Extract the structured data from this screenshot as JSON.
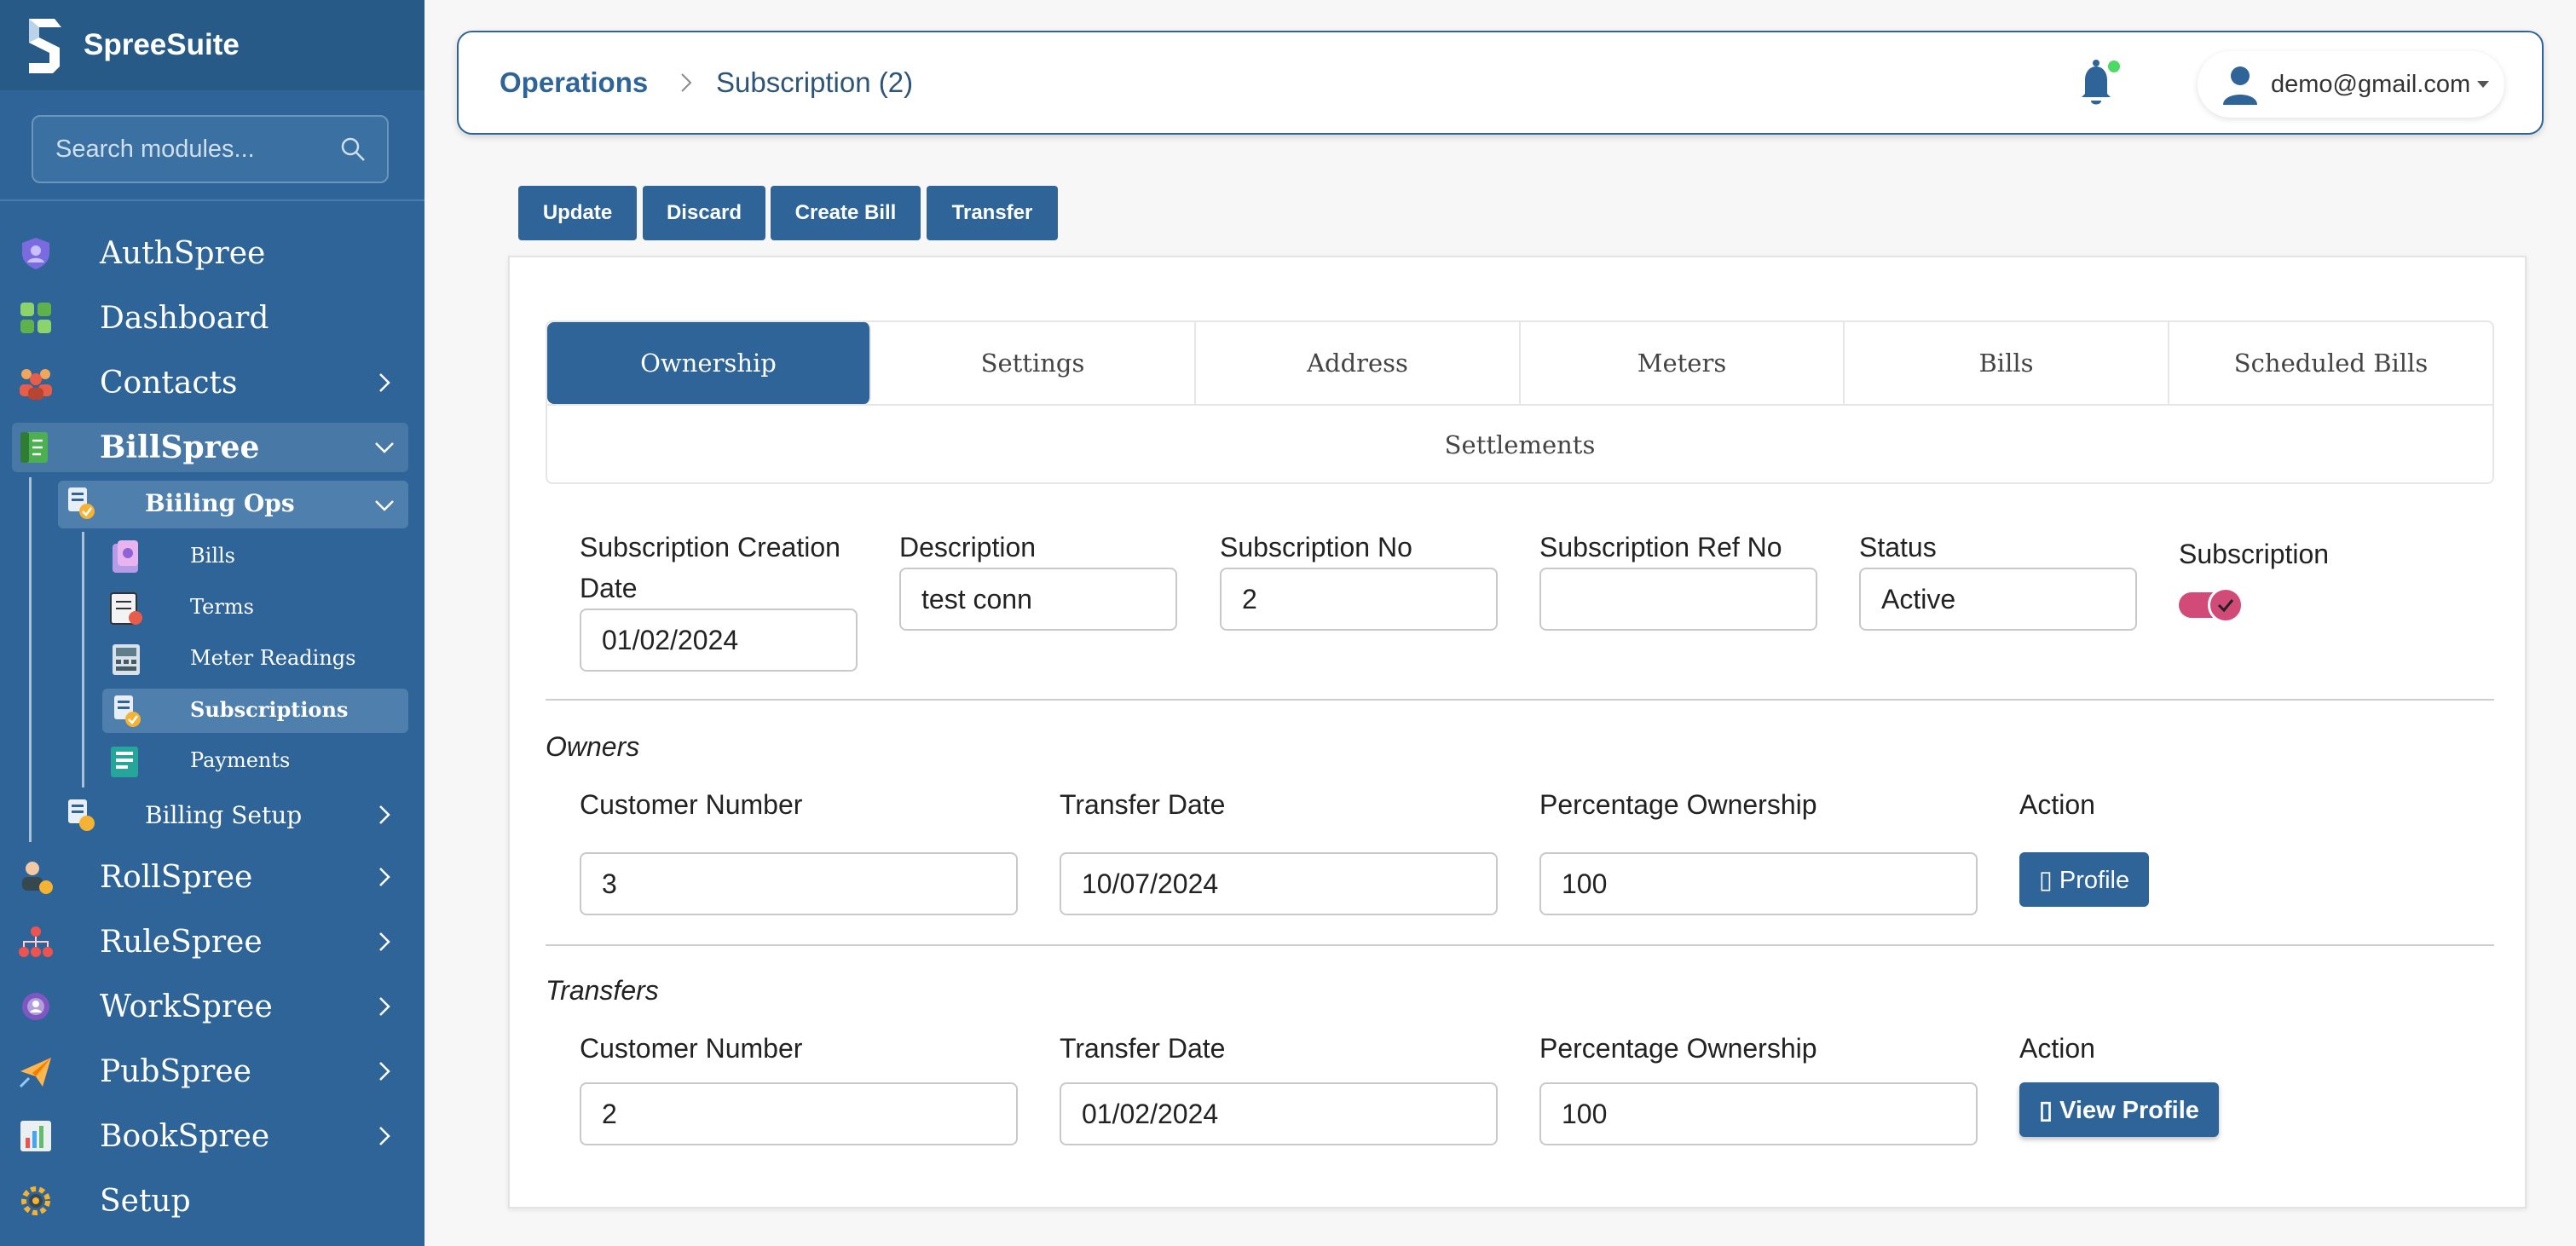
{
  "app": {
    "name": "SpreeSuite"
  },
  "search": {
    "placeholder": "Search modules..."
  },
  "sidebar": {
    "items": [
      {
        "label": "AuthSpree",
        "icon": "shield-user-icon"
      },
      {
        "label": "Dashboard",
        "icon": "dashboard-tiles-icon"
      },
      {
        "label": "Contacts",
        "icon": "contacts-group-icon"
      },
      {
        "label": "BillSpree",
        "icon": "bill-document-icon"
      },
      {
        "label": "RollSpree",
        "icon": "person-coin-icon"
      },
      {
        "label": "RuleSpree",
        "icon": "hierarchy-icon"
      },
      {
        "label": "WorkSpree",
        "icon": "gear-user-icon"
      },
      {
        "label": "PubSpree",
        "icon": "paper-plane-icon"
      },
      {
        "label": "BookSpree",
        "icon": "ledger-chart-icon"
      },
      {
        "label": "Setup",
        "icon": "settings-gear-icon"
      }
    ],
    "billspree_sub": {
      "group_label": "Biiling Ops",
      "setup_label": "Billing Setup",
      "children": [
        {
          "label": "Bills"
        },
        {
          "label": "Terms"
        },
        {
          "label": "Meter Readings"
        },
        {
          "label": "Subscriptions"
        },
        {
          "label": "Payments"
        }
      ]
    }
  },
  "header": {
    "breadcrumb_root": "Operations",
    "breadcrumb_current": "Subscription (2)",
    "user_email": "demo@gmail.com"
  },
  "toolbar": {
    "update": "Update",
    "discard": "Discard",
    "create_bill": "Create Bill",
    "transfer": "Transfer"
  },
  "tabs": [
    "Ownership",
    "Settings",
    "Address",
    "Meters",
    "Bills",
    "Scheduled Bills",
    "Settlements"
  ],
  "form": {
    "creation_date_label": "Subscription Creation Date",
    "creation_date": "01/02/2024",
    "description_label": "Description",
    "description": "test conn",
    "sub_no_label": "Subscription No",
    "sub_no": "2",
    "ref_no_label": "Subscription Ref No",
    "ref_no": "",
    "status_label": "Status",
    "status": "Active",
    "subscription_label": "Subscription",
    "subscription_on": true
  },
  "owners": {
    "title": "Owners",
    "headers": [
      "Customer Number",
      "Transfer Date",
      "Percentage Ownership",
      "Action"
    ],
    "rows": [
      {
        "customer": "3",
        "date": "10/07/2024",
        "pct": "100",
        "action": "▯ Profile"
      }
    ]
  },
  "transfers": {
    "title": "Transfers",
    "headers": [
      "Customer Number",
      "Transfer Date",
      "Percentage Ownership",
      "Action"
    ],
    "rows": [
      {
        "customer": "2",
        "date": "01/02/2024",
        "pct": "100",
        "action": "▯ View Profile"
      }
    ]
  },
  "colors": {
    "primary": "#2e6497",
    "sidebar": "#2e6497",
    "toggle": "#d24a78",
    "notify_dot": "#4cd964"
  }
}
